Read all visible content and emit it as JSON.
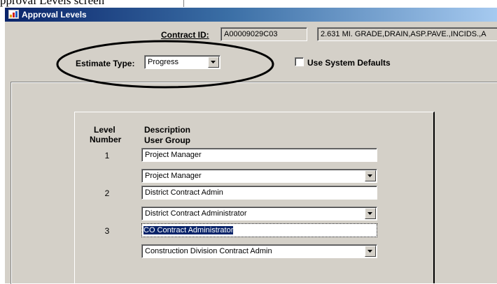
{
  "window": {
    "title": "Approval Levels"
  },
  "top_strip": {
    "text": "pproval Levels screen"
  },
  "contract": {
    "id_label": "Contract ID:",
    "id_value": "A00009029C03",
    "description_value": "2.631 MI. GRADE,DRAIN,ASP.PAVE.,INCIDS.,A"
  },
  "estimate_type": {
    "label": "Estimate Type:",
    "value": "Progress"
  },
  "use_system_defaults": {
    "label": "Use System Defaults",
    "checked": false
  },
  "levels_panel": {
    "col_level_header_1": "Level",
    "col_level_header_2": "Number",
    "col_description_header": "Description",
    "col_user_group_header": "User Group",
    "levels": [
      {
        "number": "1",
        "description": "Project Manager",
        "user_group": "Project Manager"
      },
      {
        "number": "2",
        "description": "District Contract Admin",
        "user_group": "District Contract Administrator"
      },
      {
        "number": "3",
        "description": "CO Contract Administrator",
        "user_group": "Construction Division Contract Admin"
      }
    ]
  },
  "colors": {
    "titlebar_start": "#0a246a",
    "titlebar_end": "#a6caf0",
    "window_face": "#d4d0c8",
    "selection": "#0a246a"
  }
}
